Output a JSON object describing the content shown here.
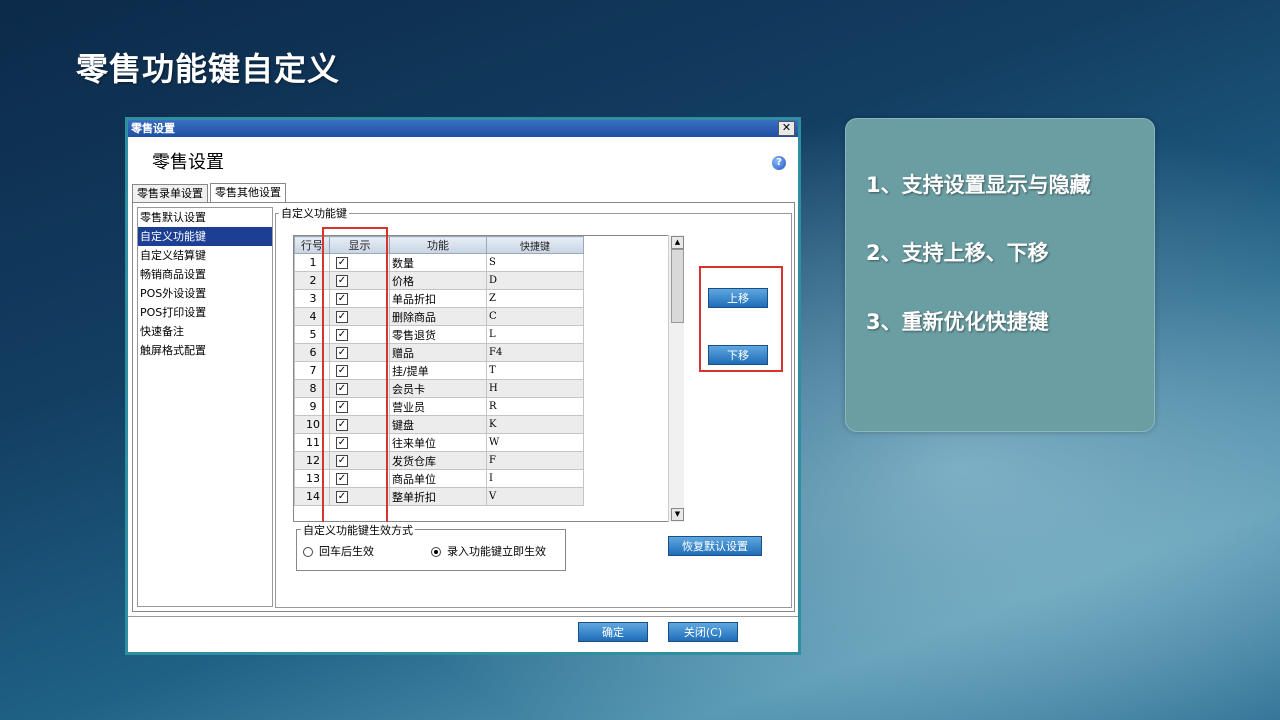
{
  "slide": {
    "title": "零售功能键自定义"
  },
  "window": {
    "titlebar": "零售设置",
    "close_glyph": "✕",
    "header_title": "零售设置",
    "help_glyph": "?",
    "tabs": [
      "零售录单设置",
      "零售其他设置"
    ],
    "active_tab": "零售其他设置",
    "nav_items": [
      "零售默认设置",
      "自定义功能键",
      "自定义结算键",
      "畅销商品设置",
      "POS外设设置",
      "POS打印设置",
      "快速备注",
      "触屏格式配置"
    ],
    "selected_nav": "自定义功能键",
    "group_title": "自定义功能键",
    "grid": {
      "columns": [
        "行号",
        "显示",
        "功能",
        "快捷键"
      ],
      "rows": [
        {
          "no": "1",
          "show": true,
          "func": "数量",
          "key": "S"
        },
        {
          "no": "2",
          "show": true,
          "func": "价格",
          "key": "D"
        },
        {
          "no": "3",
          "show": true,
          "func": "单品折扣",
          "key": "Z"
        },
        {
          "no": "4",
          "show": true,
          "func": "删除商品",
          "key": "C"
        },
        {
          "no": "5",
          "show": true,
          "func": "零售退货",
          "key": "L"
        },
        {
          "no": "6",
          "show": true,
          "func": "赠品",
          "key": "F4"
        },
        {
          "no": "7",
          "show": true,
          "func": "挂/提单",
          "key": "T"
        },
        {
          "no": "8",
          "show": true,
          "func": "会员卡",
          "key": "H"
        },
        {
          "no": "9",
          "show": true,
          "func": "营业员",
          "key": "R"
        },
        {
          "no": "10",
          "show": true,
          "func": "键盘",
          "key": "K"
        },
        {
          "no": "11",
          "show": true,
          "func": "往来单位",
          "key": "W"
        },
        {
          "no": "12",
          "show": true,
          "func": "发货仓库",
          "key": "F"
        },
        {
          "no": "13",
          "show": true,
          "func": "商品单位",
          "key": "I"
        },
        {
          "no": "14",
          "show": true,
          "func": "整单折扣",
          "key": "V"
        }
      ],
      "check_glyph": "✓"
    },
    "move_up": "上移",
    "move_down": "下移",
    "mode_group_title": "自定义功能键生效方式",
    "mode_options": [
      "回车后生效",
      "录入功能键立即生效"
    ],
    "mode_selected": "录入功能键立即生效",
    "restore_default": "恢复默认设置",
    "ok": "确定",
    "close": "关闭(C)"
  },
  "info": {
    "lines": [
      "1、支持设置显示与隐藏",
      "2、支持上移、下移",
      "3、重新优化快捷键"
    ]
  },
  "colors": {
    "highlight": "#d9342b",
    "selection": "#1c3f93",
    "panel": "#6a9ea3"
  }
}
